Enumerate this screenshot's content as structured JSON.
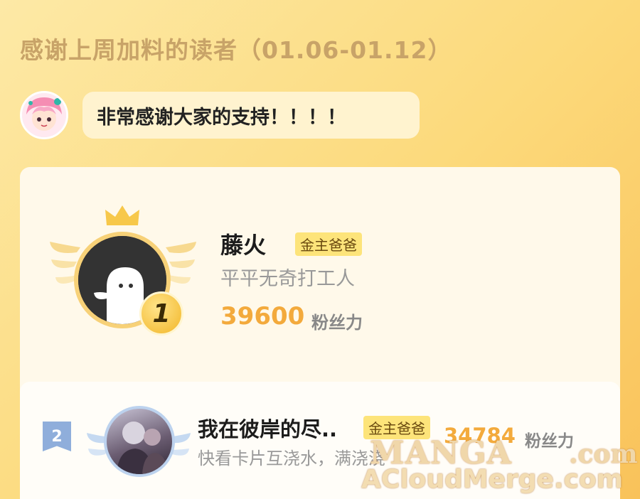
{
  "header": {
    "title": "感谢上周加料的读者（01.06-01.12）"
  },
  "author_message": {
    "text": "非常感谢大家的支持！！！！"
  },
  "ranking": [
    {
      "rank": "1",
      "name": "藤火",
      "badge": "金主爸爸",
      "subtitle": "平平无奇打工人",
      "score": "39600",
      "score_unit": "粉丝力"
    },
    {
      "rank": "2",
      "name": "我在彼岸的尽..",
      "badge": "金主爸爸",
      "subtitle": "快看卡片互浇水，满浇浇",
      "score": "34784",
      "score_unit": "粉丝力"
    }
  ],
  "watermark": {
    "line1": "MANGA",
    "line1_suffix": ".com",
    "line2": "ACloudMerge.com"
  },
  "colors": {
    "score": "#f3aa3c",
    "badge_bg": "#fde47a",
    "heading": "#c8a368"
  }
}
